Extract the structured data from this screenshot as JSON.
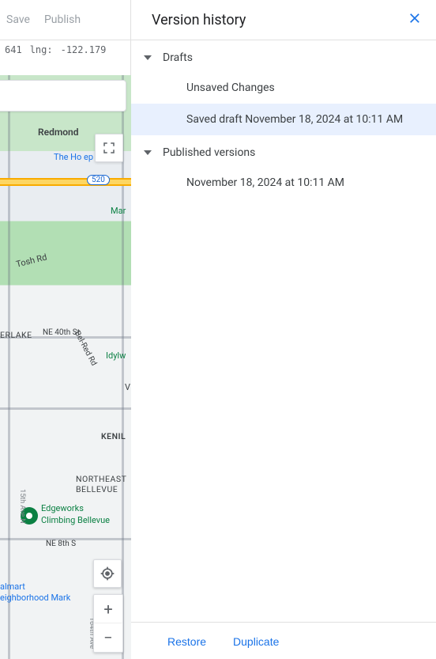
{
  "toolbar": {
    "save": "Save",
    "publish": "Publish"
  },
  "coords": {
    "lat_label": "641",
    "lng_label": "lng:",
    "lng_value": "-122.179"
  },
  "map": {
    "redmond": "Redmond",
    "home_depot": "The Ho         ep",
    "marymoor": "Mar",
    "tosh": "Tosh Rd",
    "erlake": "ERLAKE",
    "ne40": "NE 40th St",
    "belred": "Bel-Red Rd",
    "idylw": "Idylw",
    "v": "V",
    "kenil": "KENIL",
    "ne_bellevue": "NORTHEAST\nBELLEVUE",
    "edgeworks1": "Edgeworks",
    "edgeworks2": "Climbing Bellevue",
    "ne8": "NE 8th S",
    "almart1": "almart",
    "almart2": "eighborhood Mark",
    "hwy520": "520",
    "plus": "+",
    "minus": "−",
    "n15": "15th Ave N",
    "n164": "164th Ave"
  },
  "panel": {
    "title": "Version history",
    "sections": [
      {
        "title": "Drafts",
        "items": [
          "Unsaved Changes",
          "Saved draft November 18, 2024 at 10:11 AM"
        ],
        "selectedIndex": 1
      },
      {
        "title": "Published versions",
        "items": [
          "November 18, 2024 at 10:11 AM"
        ],
        "selectedIndex": -1
      }
    ],
    "restore": "Restore",
    "duplicate": "Duplicate"
  }
}
